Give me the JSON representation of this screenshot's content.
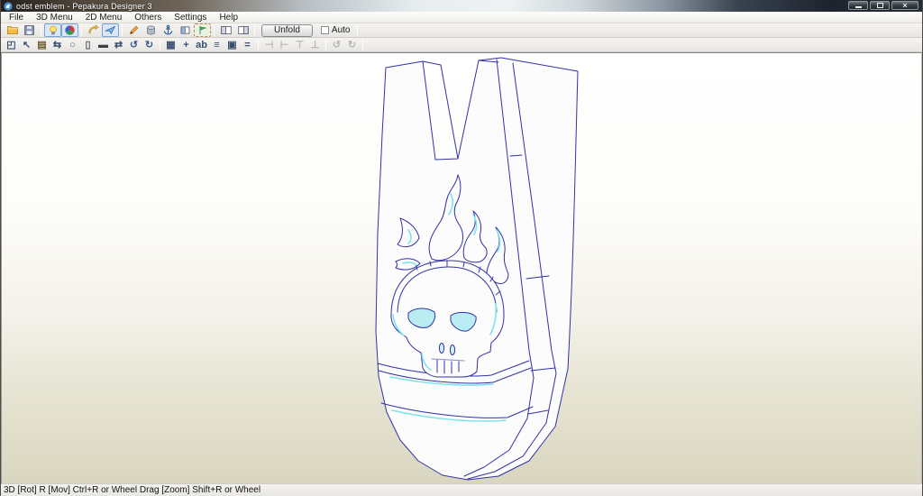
{
  "window": {
    "title": "odst emblem - Pepakura Designer 3",
    "controls": [
      {
        "name": "minimize-button",
        "glyph": "min"
      },
      {
        "name": "maximize-button",
        "glyph": "max"
      },
      {
        "name": "close-button",
        "glyph": "close"
      }
    ]
  },
  "menubar": {
    "items": [
      "File",
      "3D Menu",
      "2D Menu",
      "Others",
      "Settings",
      "Help"
    ]
  },
  "toolbar_main": {
    "items": [
      {
        "type": "icon",
        "name": "open-file-icon",
        "icon": "folder"
      },
      {
        "type": "icon",
        "name": "save-file-icon",
        "icon": "floppy"
      },
      {
        "type": "sep"
      },
      {
        "type": "icon",
        "name": "toggle-light-icon",
        "icon": "bulb",
        "active": true
      },
      {
        "type": "icon",
        "name": "toggle-texture-icon",
        "icon": "ball",
        "active": true
      },
      {
        "type": "sep"
      },
      {
        "type": "icon",
        "name": "rotate-view-icon",
        "icon": "axis"
      },
      {
        "type": "icon",
        "name": "pan-view-icon",
        "icon": "plane",
        "active": true
      },
      {
        "type": "sep"
      },
      {
        "type": "icon",
        "name": "edit-mode-icon",
        "icon": "pencil"
      },
      {
        "type": "icon",
        "name": "solid-view-icon",
        "icon": "cylinder"
      },
      {
        "type": "icon",
        "name": "anchor-tool-icon",
        "icon": "anchor"
      },
      {
        "type": "icon",
        "name": "open-box-view-icon",
        "icon": "boxhalf"
      },
      {
        "type": "icon",
        "name": "check-model-flag-icon",
        "icon": "flag",
        "dashed": true
      },
      {
        "type": "sep"
      },
      {
        "type": "icon",
        "name": "layout-3d-window-icon",
        "icon": "layoutL"
      },
      {
        "type": "icon",
        "name": "layout-2d-window-icon",
        "icon": "layoutR"
      },
      {
        "type": "sep"
      },
      {
        "type": "button",
        "name": "unfold-button",
        "label": "Unfold"
      },
      {
        "type": "checkbox",
        "name": "auto-unfold-checkbox",
        "label": "Auto",
        "checked": false
      },
      {
        "type": "sep"
      }
    ]
  },
  "toolbar_2d": {
    "items": [
      {
        "type": "icon",
        "name": "select-parts-tool-icon",
        "glyph": "◰",
        "color": "#3a4e72"
      },
      {
        "type": "icon",
        "name": "cursor-tool-icon",
        "glyph": "↖",
        "color": "#3a4e72"
      },
      {
        "type": "icon",
        "name": "stamp-image-tool-icon",
        "glyph": "▤",
        "color": "#6b5b2a"
      },
      {
        "type": "icon",
        "name": "divide-edge-tool-icon",
        "glyph": "⇆",
        "color": "#3a4e72"
      },
      {
        "type": "icon",
        "name": "cylinder-part-tool-icon",
        "glyph": "○",
        "color": "#55636f"
      },
      {
        "type": "icon",
        "name": "box-part-tool-icon",
        "glyph": "▯",
        "color": "#55636f"
      },
      {
        "type": "icon",
        "name": "flat-part-tool-icon",
        "glyph": "▬",
        "color": "#3b3f46"
      },
      {
        "type": "icon",
        "name": "flip-part-tool-icon",
        "glyph": "⇄",
        "color": "#3a4e72"
      },
      {
        "type": "icon",
        "name": "undo-icon",
        "glyph": "↺",
        "color": "#3a5a8c"
      },
      {
        "type": "icon",
        "name": "redo-icon",
        "glyph": "↻",
        "color": "#3a5a8c"
      },
      {
        "type": "sep"
      },
      {
        "type": "icon",
        "name": "select-region-tool-icon",
        "glyph": "▦",
        "color": "#3a4e72"
      },
      {
        "type": "icon",
        "name": "crosshair-tool-icon",
        "glyph": "+",
        "color": "#3a4e72"
      },
      {
        "type": "icon",
        "name": "edge-id-tool-icon",
        "glyph": "ab",
        "color": "#3a4e72"
      },
      {
        "type": "icon",
        "name": "layers-tool-icon",
        "glyph": "≡",
        "color": "#3a4e72"
      },
      {
        "type": "icon",
        "name": "frame-tool-icon",
        "glyph": "▣",
        "color": "#3a4e72"
      },
      {
        "type": "icon",
        "name": "flatten-tool-icon",
        "glyph": "=",
        "color": "#3a4e72"
      },
      {
        "type": "sep"
      },
      {
        "type": "icon",
        "name": "align-left-icon",
        "glyph": "⊣",
        "color": "#b7b5b1",
        "disabled": true
      },
      {
        "type": "icon",
        "name": "align-right-icon",
        "glyph": "⊢",
        "color": "#b7b5b1",
        "disabled": true
      },
      {
        "type": "icon",
        "name": "align-top-icon",
        "glyph": "⊤",
        "color": "#b7b5b1",
        "disabled": true
      },
      {
        "type": "icon",
        "name": "align-bottom-icon",
        "glyph": "⊥",
        "color": "#b7b5b1",
        "disabled": true
      },
      {
        "type": "sep"
      },
      {
        "type": "icon",
        "name": "rotate-ccw-icon",
        "glyph": "↺",
        "color": "#b7b5b1",
        "disabled": true
      },
      {
        "type": "icon",
        "name": "rotate-cw-icon",
        "glyph": "↻",
        "color": "#b7b5b1",
        "disabled": true
      },
      {
        "type": "sep"
      }
    ]
  },
  "canvas": {
    "model_name": "odst emblem",
    "wire_color": "#3232a6",
    "highlight_color": "#7ce4ee",
    "face_color": "#fcfcfc",
    "bg_top": "#ffffff",
    "bg_bottom": "#d9d6c0"
  },
  "statusbar": {
    "text": "3D [Rot] R [Mov] Ctrl+R or Wheel Drag [Zoom] Shift+R or Wheel"
  }
}
